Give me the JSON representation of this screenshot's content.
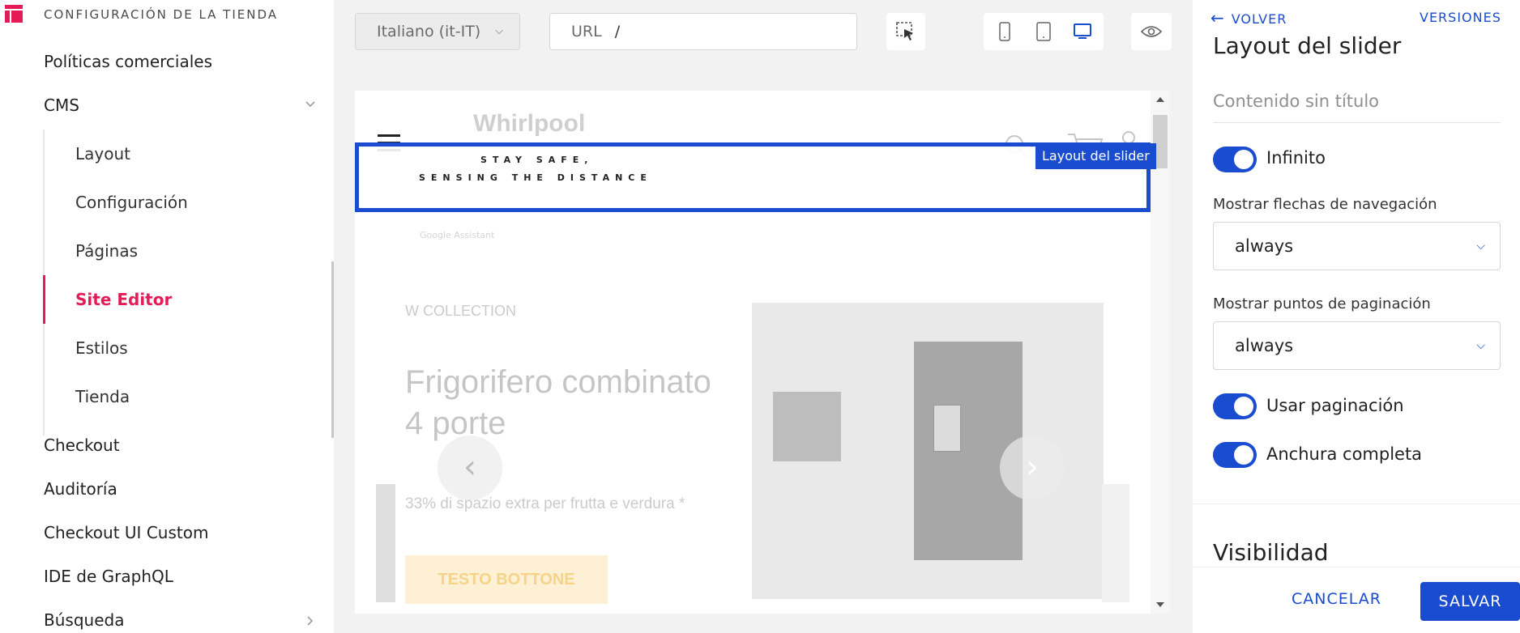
{
  "sidebar": {
    "title": "CONFIGURACIÓN DE LA TIENDA",
    "items": {
      "politicas": "Políticas comerciales",
      "cms": "CMS",
      "checkout": "Checkout",
      "auditoria": "Auditoría",
      "checkout_ui": "Checkout UI Custom",
      "graphql": "IDE de GraphQL",
      "busqueda": "Búsqueda"
    },
    "cms_sub": {
      "layout": "Layout",
      "configuracion": "Configuración",
      "paginas": "Páginas",
      "site_editor": "Site Editor",
      "estilos": "Estilos",
      "tienda": "Tienda"
    },
    "active_color": "#e31c58"
  },
  "toolbar": {
    "language": "Italiano (it-IT)",
    "url_label": "URL",
    "url_value": "/"
  },
  "preview": {
    "logo": "Whirlpool",
    "banner_line1": "STAY SAFE,",
    "banner_line2": "SENSING THE DISTANCE",
    "assistant": "Google Assistant",
    "collection": "W COLLECTION",
    "headline1": "Frigorifero combinato",
    "headline2": "4 porte",
    "subtext": "33% di spazio extra per frutta e verdura *",
    "cta": "TESTO BOTTONE",
    "highlight_label": "Layout del slider",
    "highlight_color": "#1a4ccf"
  },
  "panel": {
    "back": "VOLVER",
    "versions": "VERSIONES",
    "title": "Layout del slider",
    "name_placeholder": "Contenido sin título",
    "infinito": "Infinito",
    "arrows_label": "Mostrar flechas de navegación",
    "arrows_value": "always",
    "dots_label": "Mostrar puntos de paginación",
    "dots_value": "always",
    "use_pagination": "Usar paginación",
    "full_width": "Anchura completa",
    "visibility": "Visibilidad",
    "cancel": "CANCELAR",
    "save": "SALVAR"
  }
}
